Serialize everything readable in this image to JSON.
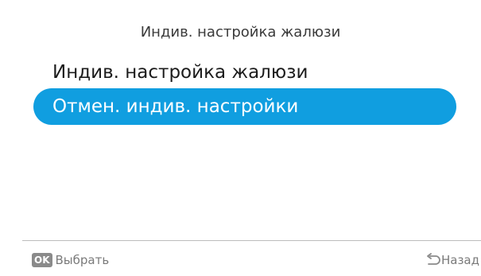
{
  "header": {
    "title": "Индив. настройка жалюзи"
  },
  "menu": {
    "items": [
      {
        "label": "Индив. настройка жалюзи",
        "selected": false
      },
      {
        "label": "Отмен. индив. настройки",
        "selected": true
      }
    ]
  },
  "footer": {
    "ok_badge": "OK",
    "select_label": "Выбрать",
    "back_label": "Назад",
    "back_icon": "return-arrow-icon"
  },
  "colors": {
    "selection": "#109ee0",
    "background": "#ffffff",
    "footer_text": "#7a7a7a",
    "ok_badge_bg": "#8a8a8a"
  }
}
